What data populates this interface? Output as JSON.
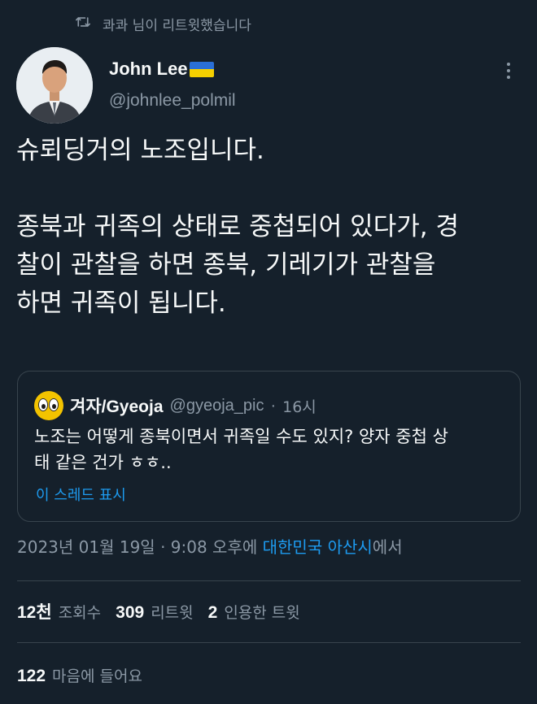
{
  "retweet": {
    "text": "콰콰 님이 리트윗했습니다",
    "icon": "retweet-icon"
  },
  "author": {
    "display_name": "John Lee",
    "handle": "@johnlee_polmil",
    "flag_icon": "ukraine-flag-icon",
    "flag_colors": [
      "#2a6fd6",
      "#f5d000"
    ]
  },
  "tweet": {
    "lines": [
      "슈뢰딩거의 노조입니다.",
      "",
      "종북과 귀족의 상태로 중첩되어 있다가, 경",
      "찰이 관찰을 하면 종북, 기레기가 관찰을",
      "하면 귀족이 됩니다."
    ]
  },
  "quote": {
    "display_name": "겨자/Gyeoja",
    "handle": "@gyeoja_pic",
    "separator": "·",
    "time": "16시",
    "lines": [
      "노조는 어떻게 종북이면서 귀족일 수도 있지? 양자 중첩 상",
      "태 같은 건가 ㅎㅎ.."
    ],
    "thread_link": "이 스레드 표시"
  },
  "meta": {
    "datetime": "2023년 01월 19일 · 9:08 오후에 ",
    "place": "대한민국 아산시",
    "suffix": "에서"
  },
  "stats": {
    "views_count": "12천",
    "views_label": "조회수",
    "retweets_count": "309",
    "retweets_label": "리트윗",
    "quotes_count": "2",
    "quotes_label": "인용한 트윗"
  },
  "likes": {
    "count": "122",
    "label": "마음에 들어요"
  },
  "colors": {
    "background": "#15202b",
    "text": "#f7f9f9",
    "secondary": "#8b98a5",
    "accent": "#1d9bf0",
    "border": "#38444d"
  }
}
